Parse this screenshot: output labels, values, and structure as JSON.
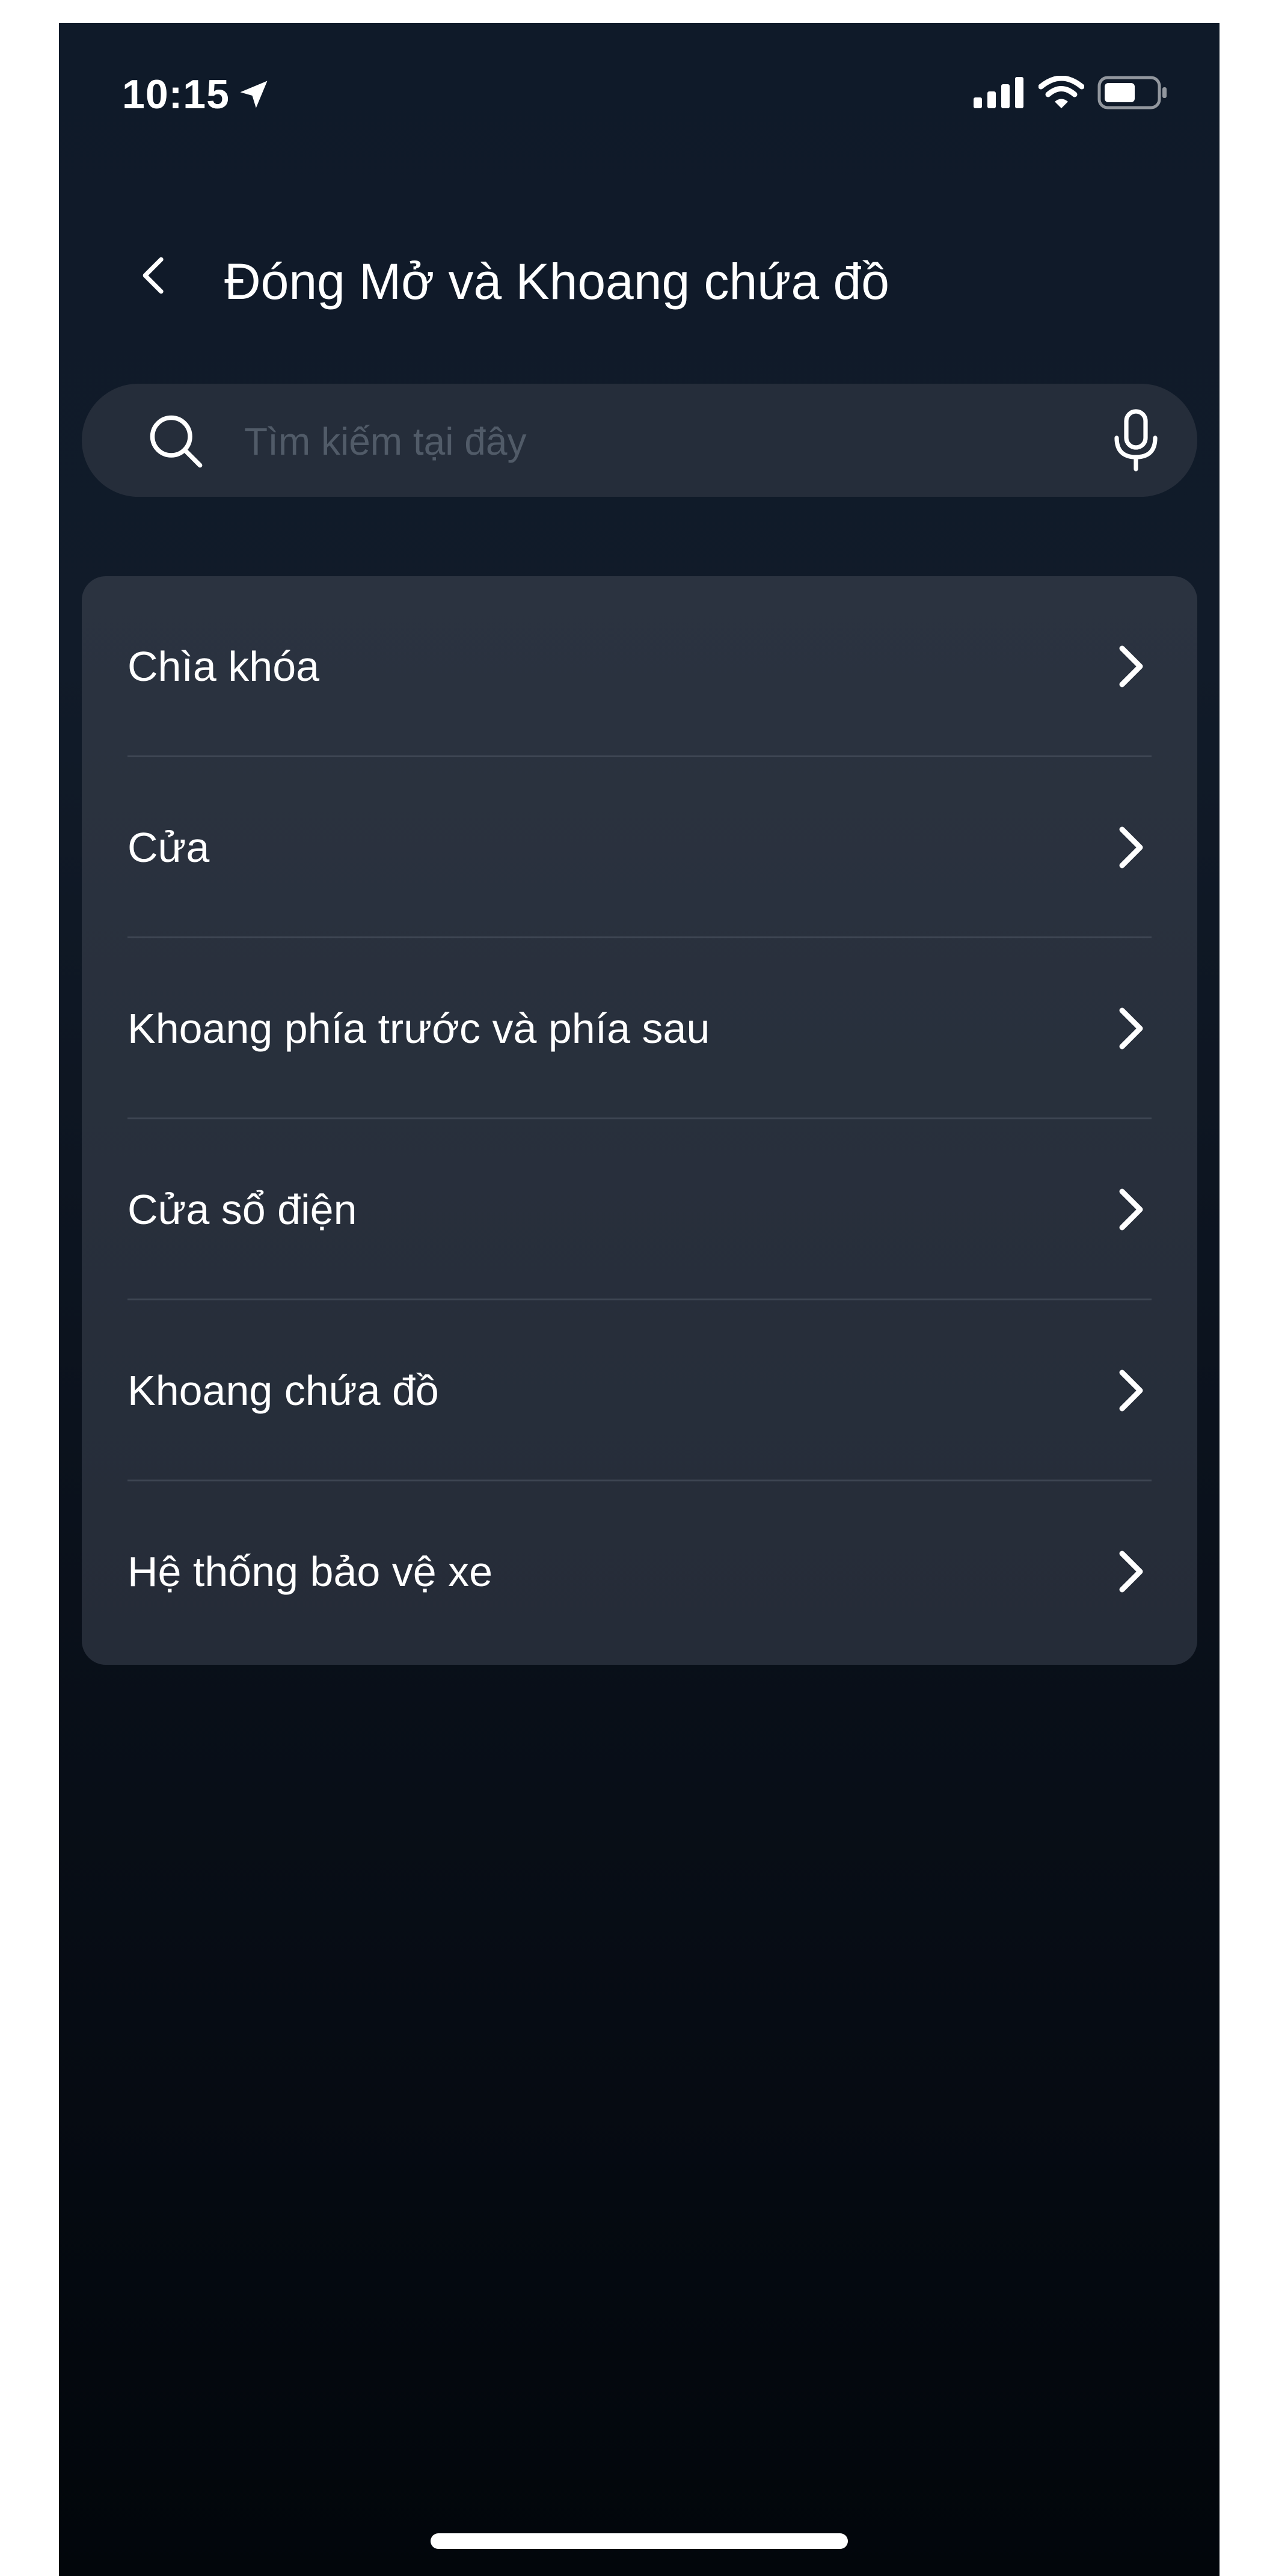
{
  "status_bar": {
    "time": "10:15",
    "icons": [
      "location-arrow-icon",
      "cellular-signal-icon",
      "wifi-icon",
      "battery-icon"
    ]
  },
  "header": {
    "back_icon": "chevron-left-icon",
    "title": "Đóng Mở và Khoang chứa đồ"
  },
  "search": {
    "placeholder": "Tìm kiếm tại đây",
    "value": "",
    "search_icon": "search-icon",
    "mic_icon": "microphone-icon"
  },
  "menu": {
    "items": [
      {
        "label": "Chìa khóa"
      },
      {
        "label": "Cửa"
      },
      {
        "label": "Khoang phía trước và phía sau"
      },
      {
        "label": "Cửa sổ điện"
      },
      {
        "label": "Khoang chứa đồ"
      },
      {
        "label": "Hệ thống bảo vệ xe"
      }
    ],
    "chevron_icon": "chevron-right-icon"
  },
  "colors": {
    "background_top": "#0f1a29",
    "background_bottom": "#02060b",
    "card": "#2b3340",
    "search_field": "#252d3a",
    "placeholder": "#515b68",
    "divider": "#3e4653",
    "text": "#ffffff"
  }
}
